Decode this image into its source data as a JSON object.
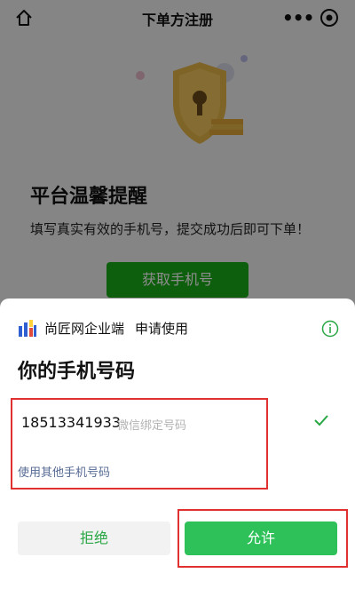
{
  "nav": {
    "title": "下单方注册",
    "more_icon": "more-dots-icon",
    "close_icon": "capsule-close-icon",
    "home_icon": "home-icon"
  },
  "page": {
    "hero_icon": "shield-lock-illustration",
    "heading": "平台温馨提醒",
    "description": "填写真实有效的手机号，提交成功后即可下单！",
    "get_phone_label": "获取手机号"
  },
  "sheet": {
    "app_name": "尚匠网企业端",
    "action": "申请使用",
    "title": "你的手机号码",
    "phone_number": "18513341933",
    "phone_hint": "微信绑定号码",
    "other_phone_label": "使用其他手机号码",
    "reject_label": "拒绝",
    "allow_label": "允许"
  },
  "colors": {
    "primary_green": "#2ec15a",
    "link_blue": "#576b95",
    "highlight_red": "#e03030"
  }
}
